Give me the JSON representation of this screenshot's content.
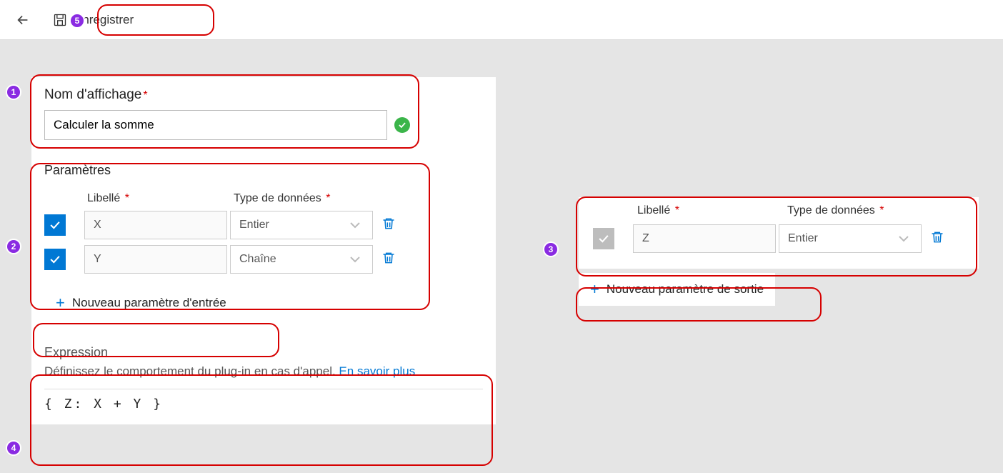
{
  "toolbar": {
    "save_label": "Enregistrer"
  },
  "name_section": {
    "label": "Nom d'affichage",
    "value": "Calculer la somme"
  },
  "params_section": {
    "title": "Paramètres",
    "col_label": "Libellé",
    "col_type": "Type de données",
    "rows": [
      {
        "label": "X",
        "type": "Entier"
      },
      {
        "label": "Y",
        "type": "Chaîne"
      }
    ],
    "add_input_label": "Nouveau paramètre d'entrée"
  },
  "output_section": {
    "col_label": "Libellé",
    "col_type": "Type de données",
    "rows": [
      {
        "label": "Z",
        "type": "Entier"
      }
    ],
    "add_output_label": "Nouveau paramètre de sortie"
  },
  "expression_section": {
    "title": "Expression",
    "desc": "Définissez le comportement du plug-in en cas d'appel. ",
    "link": "En savoir plus",
    "code": "{ Z: X + Y }"
  },
  "callouts": [
    "1",
    "2",
    "3",
    "4",
    "5"
  ]
}
